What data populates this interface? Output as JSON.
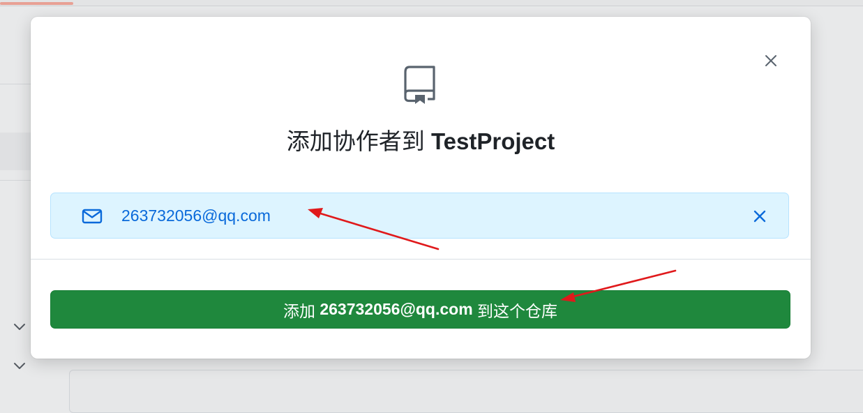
{
  "modal": {
    "title_prefix": "添加协作者到 ",
    "repo_name": "TestProject",
    "icon": "repo-icon",
    "close_icon": "close-icon"
  },
  "selected_user": {
    "email": "263732056@qq.com",
    "icon": "mail-icon",
    "remove_icon": "close-icon"
  },
  "add_button": {
    "prefix": "添加 ",
    "email": "263732056@qq.com",
    "suffix": " 到这个仓库"
  },
  "colors": {
    "primary_button": "#1f883d",
    "chip_background": "#ddf4ff",
    "chip_text": "#0969da",
    "annotation_arrow": "#e0191b"
  }
}
